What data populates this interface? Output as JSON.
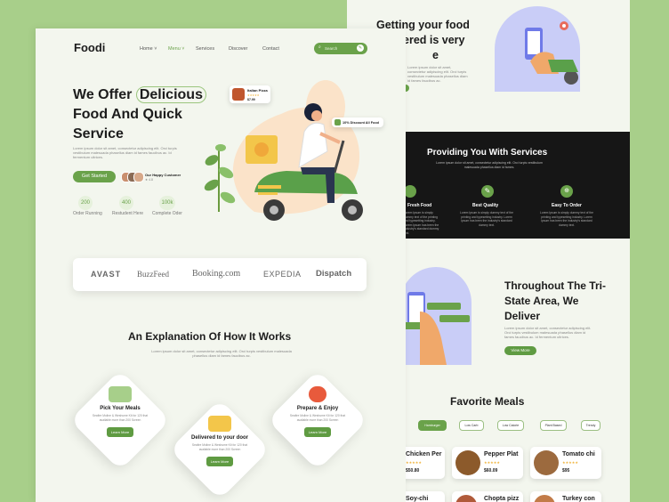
{
  "brand": "Foodi",
  "nav": {
    "items": [
      "Home",
      "Menu",
      "Services",
      "Discover",
      "Contact"
    ],
    "search_placeholder": "Search"
  },
  "hero": {
    "title_line1_a": "We Offer ",
    "title_line1_b": "Delicious",
    "title_line2": "Food And Quick",
    "title_line3": "Service",
    "description": "Lorem ipsum dolor sit amet, consectetur adipiscing elit. Orci turpis vestibulum malesuada phasellus diam id fames faucibus ac. Id fermentum ultrices.",
    "cta": "Get Started",
    "customers_title": "Our Happy Customer",
    "customers_rating": "★ 4.8",
    "stats": [
      {
        "value": "200",
        "label": "Order Running"
      },
      {
        "value": "400",
        "label": "Restudent Here"
      },
      {
        "value": "100k",
        "label": "Complete Oder"
      }
    ],
    "float_card_title": "Italian Pizza",
    "float_card_stars": "★★★★★",
    "float_card_price": "$7.99",
    "discount_badge": "10% Discount All Food"
  },
  "partners": [
    "AVAST",
    "BuzzFeed",
    "Booking.com",
    "EXPEDIA",
    "Dispatch"
  ],
  "how": {
    "title": "An Explanation Of How It Works",
    "subtitle": "Lorem ipsum dolor sit amet, consectetur adipiscing elit. Orci turpis vestibulum malesuada phasellus diam id fames faucibus ac.",
    "steps": [
      {
        "title": "Pick Your Meals",
        "text": "Seafire Moline & Weshume Kit for 120 that available more than 200 Screen",
        "button": "Learn More"
      },
      {
        "title": "Delivered to your door",
        "text": "Seafire Moline & Weshume Kit for 120 that available more than 200 Screen",
        "button": "Learn More"
      },
      {
        "title": "Prepare & Enjoy",
        "text": "Seafire Moline & Weshume Kit for 120 that available more than 200 Screen",
        "button": "Learn More"
      }
    ]
  },
  "back": {
    "getting_line1": "Getting your food",
    "getting_line2": "ered is very",
    "getting_line3": "e",
    "getting_text": "Lorem ipsum dolor sit amet, consectetur adipiscing elit. Orci turpis vestibulum malesuada phasellus diam id fames faucibus ac.",
    "services_title": "Providing You With Services",
    "services_text": "Lorem ipsum dolor sit amet, consectetur adipiscing elit. Orci turpis vestibulum malesuada phasellus diam id fames.",
    "services": [
      {
        "title": "Fresh Food",
        "text": "Lorem Ipsum is simply dummy text of the printing and typesetting industry. Lorem Ipsum has been the industry's standard dummy text."
      },
      {
        "title": "Best Quality",
        "text": "Lorem Ipsum is simply dummy text of the printing and typesetting industry. Lorem Ipsum has been the industry's standard dummy text."
      },
      {
        "title": "Easy To Order",
        "text": "Lorem Ipsum is simply dummy text of the printing and typesetting industry. Lorem Ipsum has been the industry's standard dummy text."
      }
    ],
    "tristate_line1": "Throughout The Tri-",
    "tristate_line2": "State Area, We",
    "tristate_line3": "Deliver",
    "tristate_text": "Lorem ipsum dolor sit amet, consectetur adipiscing elit. Orci turpis vestibulum malesuada phasellus diam id fames faucibus ac. Id fermentum ultrices.",
    "tristate_button": "View More",
    "favorites_title": "Favorite Meals",
    "filters": [
      "Hamburger",
      "Low Carb",
      "Low Calorie",
      "Plant Based",
      "Trendy"
    ],
    "meals": [
      {
        "name": "Chicken Per",
        "stars": "★★★★★",
        "price": "$50.80"
      },
      {
        "name": "Pepper Plat",
        "stars": "★★★★★",
        "price": "$60.09"
      },
      {
        "name": "Tomato chi",
        "stars": "★★★★★",
        "price": "$95"
      },
      {
        "name": "Soy-chi",
        "stars": "",
        "price": ""
      },
      {
        "name": "Chopta pizz",
        "stars": "",
        "price": ""
      },
      {
        "name": "Turkey con",
        "stars": "",
        "price": ""
      }
    ]
  },
  "colors": {
    "accent": "#6aa24a",
    "background": "#a8cf8a",
    "page": "#f3f6ee",
    "dark": "#161616"
  }
}
